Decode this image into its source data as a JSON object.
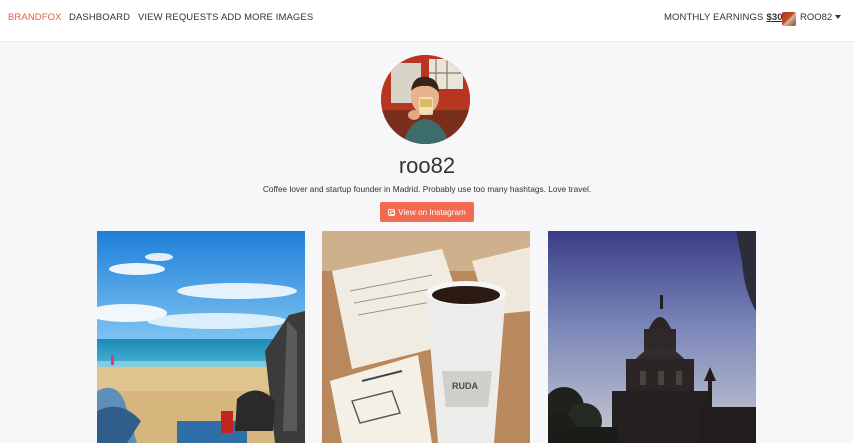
{
  "nav": {
    "brand": "BRANDFOX",
    "links": [
      "DASHBOARD",
      "VIEW REQUESTS",
      "ADD MORE IMAGES"
    ],
    "earnings_label": "MONTHLY EARNINGS",
    "earnings_value": "$30",
    "user": "ROO82"
  },
  "profile": {
    "username": "roo82",
    "bio": "Coffee lover and startup founder in Madrid. Probably use too many hashtags. Love travel.",
    "button_label": "View on Instagram"
  },
  "photos": [
    {
      "subject": "beach"
    },
    {
      "subject": "coffee"
    },
    {
      "subject": "cathedral"
    }
  ],
  "colors": {
    "accent": "#f0593e",
    "button": "#f26a4f"
  }
}
